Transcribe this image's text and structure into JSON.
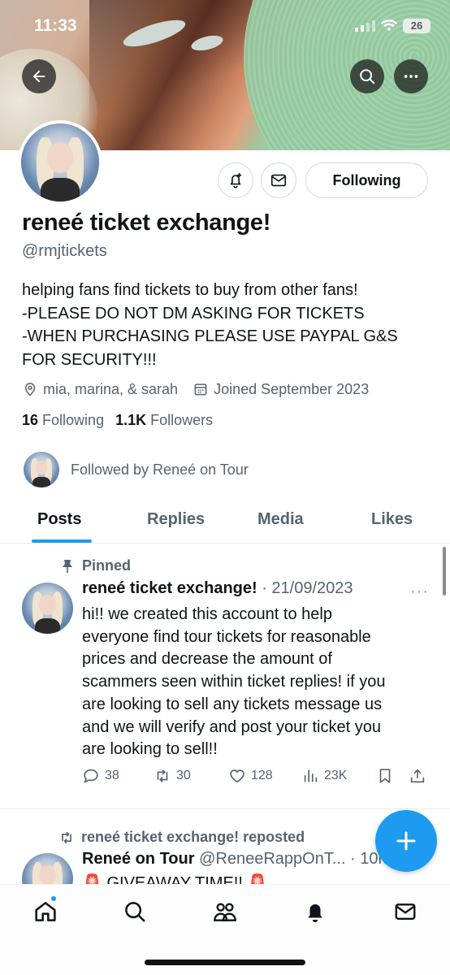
{
  "status_bar": {
    "time": "11:33",
    "battery": "26"
  },
  "profile": {
    "display_name": "reneé ticket exchange!",
    "handle": "@rmjtickets",
    "bio_lines": [
      "helping fans find tickets to buy from other fans!",
      "-PLEASE DO NOT DM ASKING FOR TICKETS",
      "-WHEN PURCHASING PLEASE USE PAYPAL G&S",
      "FOR SECURITY!!!"
    ],
    "location": "mia, marina, & sarah",
    "joined": "Joined September 2023",
    "following_count": "16",
    "following_label": "Following",
    "followers_count": "1.1K",
    "followers_label": "Followers",
    "followed_by": "Followed by Reneé on Tour",
    "following_button": "Following"
  },
  "tabs": [
    {
      "label": "Posts",
      "active": true
    },
    {
      "label": "Replies",
      "active": false
    },
    {
      "label": "Media",
      "active": false
    },
    {
      "label": "Likes",
      "active": false
    }
  ],
  "pinned_post": {
    "pinned_label": "Pinned",
    "author": "reneé ticket exchange!",
    "date": "· 21/09/2023",
    "more": "···",
    "text_lines": [
      "hi!! we created this account to help",
      "everyone find tour tickets for reasonable",
      "prices and decrease the amount of",
      "scammers seen within ticket replies! if you",
      "are looking to sell any tickets message us",
      "and we will verify and post your ticket you",
      "are looking to sell!!"
    ],
    "replies": "38",
    "reposts": "30",
    "likes": "128",
    "views": "23K"
  },
  "repost": {
    "repost_label": "reneé ticket exchange! reposted",
    "author": "Reneé on Tour",
    "handle": "@ReneeRappOnT... · 10h",
    "text": "🚨 GIVEAWAY TIME!! 🚨"
  },
  "colors": {
    "accent": "#1d9bf0",
    "text": "#0f1419",
    "muted": "#536471"
  }
}
